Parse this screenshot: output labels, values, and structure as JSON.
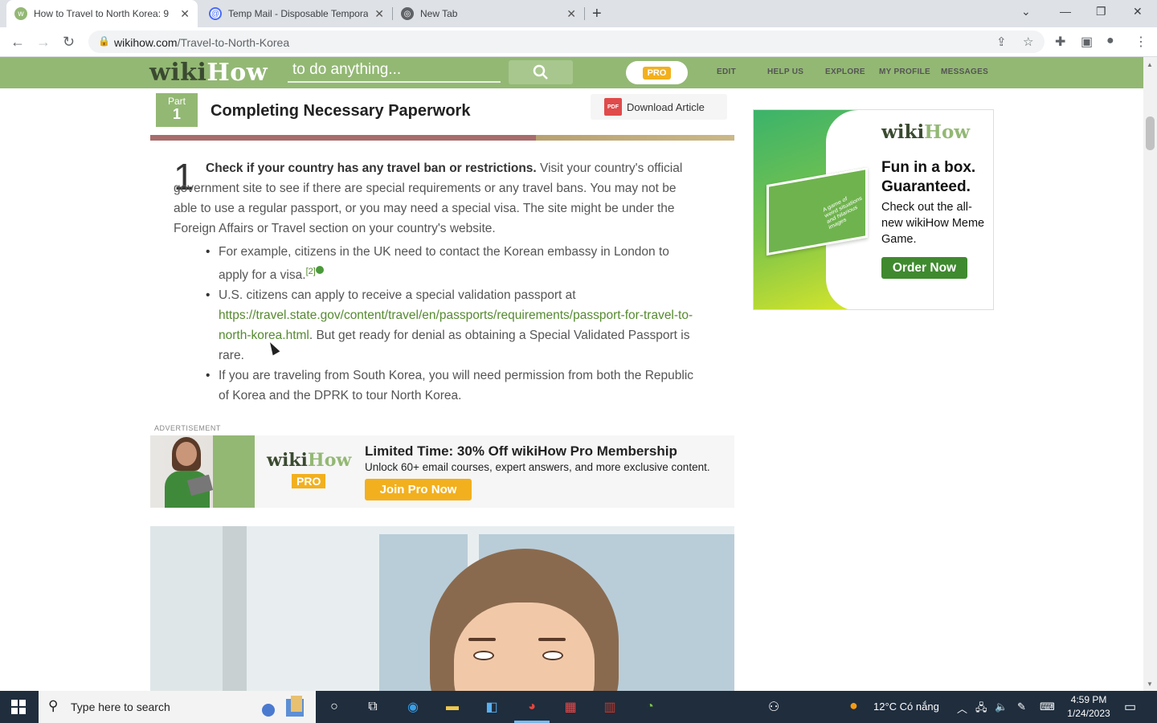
{
  "browser": {
    "tabs": [
      {
        "title": "How to Travel to North Korea: 9 ",
        "active": true
      },
      {
        "title": "Temp Mail - Disposable Tempora",
        "active": false
      },
      {
        "title": "New Tab",
        "active": false
      }
    ],
    "url_domain": "wikihow.com",
    "url_path": "/Travel-to-North-Korea"
  },
  "wikihow": {
    "logo_wiki": "wiki",
    "logo_how": "How",
    "search_placeholder": "to do anything...",
    "pro_label": "PRO",
    "nav": [
      "EDIT",
      "HELP US",
      "EXPLORE",
      "MY PROFILE",
      "MESSAGES"
    ]
  },
  "article": {
    "part_label": "Part",
    "part_number": "1",
    "part_title": "Completing Necessary Paperwork",
    "download_label": "Download Article",
    "pdf_label": "PDF",
    "step_number": "1",
    "step_bold": "Check if your country has any travel ban or restrictions.",
    "step_text": " Visit your country's official government site to see if there are special requirements or any travel bans. You may not be able to use a regular passport, or you may need a special visa. The site might be under the Foreign Affairs or Travel section on your country's website.",
    "bullets": {
      "b1_text": "For example, citizens in the UK need to contact the Korean embassy in London to apply for a visa.",
      "b1_ref": "[2]",
      "b2_pre": "U.S. citizens can apply to receive a special validation passport at ",
      "b2_link": "https://travel.state.gov/content/travel/en/passports/requirements/passport-for-travel-to-north-korea.html",
      "b2_post": ". But get ready for denial as obtaining a Special Validated Passport is rare.",
      "b3_text": "If you are traveling from South Korea, you will need permission from both the Republic of Korea and the DPRK to tour North Korea."
    }
  },
  "ad_banner": {
    "label": "ADVERTISEMENT",
    "logo_wiki": "wiki",
    "logo_how": "How",
    "pro": "PRO",
    "headline": "Limited Time: 30% Off wikiHow Pro Membership",
    "sub": "Unlock 60+ email courses, expert answers, and more exclusive content.",
    "button": "Join Pro Now"
  },
  "side_ad": {
    "logo_wiki": "wiki",
    "logo_how": "How",
    "headline_1": "Fun in a box.",
    "headline_2": "Guaranteed.",
    "body": "Check out the all-new wikiHow Meme Game.",
    "button": "Order Now",
    "box_text": "A game of weird situations and hilarious images"
  },
  "taskbar": {
    "search_placeholder": "Type here to search",
    "weather": "12°C  Có nắng",
    "time": "4:59 PM",
    "date": "1/24/2023"
  }
}
